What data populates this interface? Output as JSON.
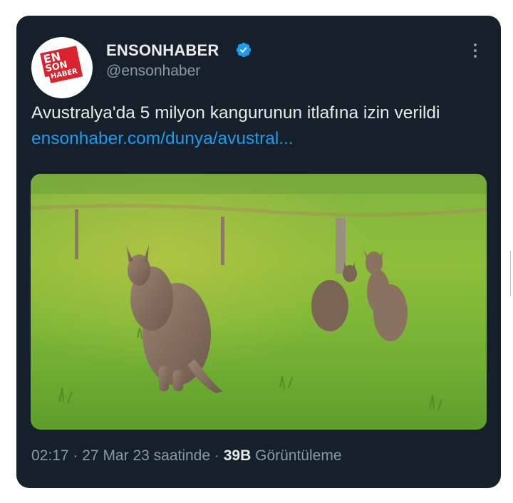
{
  "tweet": {
    "avatar_logo_text": [
      "EN",
      "SON",
      "HABER"
    ],
    "display_name": "ENSONHABER",
    "verified": true,
    "handle": "@ensonhaber",
    "more_icon": "more-vertical-icon",
    "text": "Avustralya'da 5 milyon kangurunun itlafına izin verildi",
    "link": "ensonhaber.com/dunya/avustral...",
    "media": {
      "subject": "kangaroos-in-field-photo"
    },
    "time": "02:17",
    "separator": "·",
    "date": "27 Mar 23 saatinde",
    "views_count": "39B",
    "views_label": "Görüntüleme"
  },
  "colors": {
    "card_bg": "#15202b",
    "primary_text": "#e7e9ea",
    "secondary_text": "#8b98a5",
    "link": "#1d9bf0",
    "verified_badge": "#1d9bf0",
    "logo_red": "#d9232e"
  }
}
